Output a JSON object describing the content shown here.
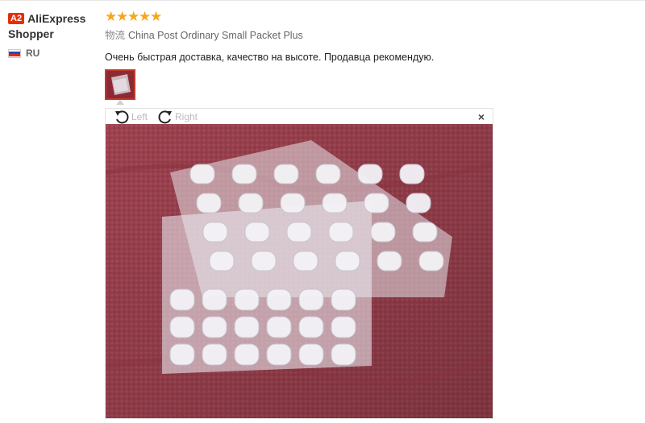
{
  "reviewer": {
    "badge": "A2",
    "name_line1": "AliExpress",
    "name_line2": "Shopper",
    "country_code": "RU",
    "flag_colors": [
      "#ffffff",
      "#1f4fb8",
      "#d52b1e"
    ]
  },
  "review": {
    "rating": 5,
    "rating_max": 5,
    "star_glyph": "★",
    "logistics_label": "物流",
    "logistics_value": "China Post Ordinary Small Packet Plus",
    "text": "Очень быстрая доставка, качество на высоте. Продавца рекомендую."
  },
  "viewer": {
    "rotate_left_label": "Left",
    "rotate_right_label": "Right",
    "close_glyph": "×",
    "icons": [
      "rotate-left-icon",
      "rotate-right-icon",
      "close-icon"
    ]
  },
  "colors": {
    "accent": "#e62e04",
    "star": "#f5a623",
    "towel": "#a54553"
  }
}
